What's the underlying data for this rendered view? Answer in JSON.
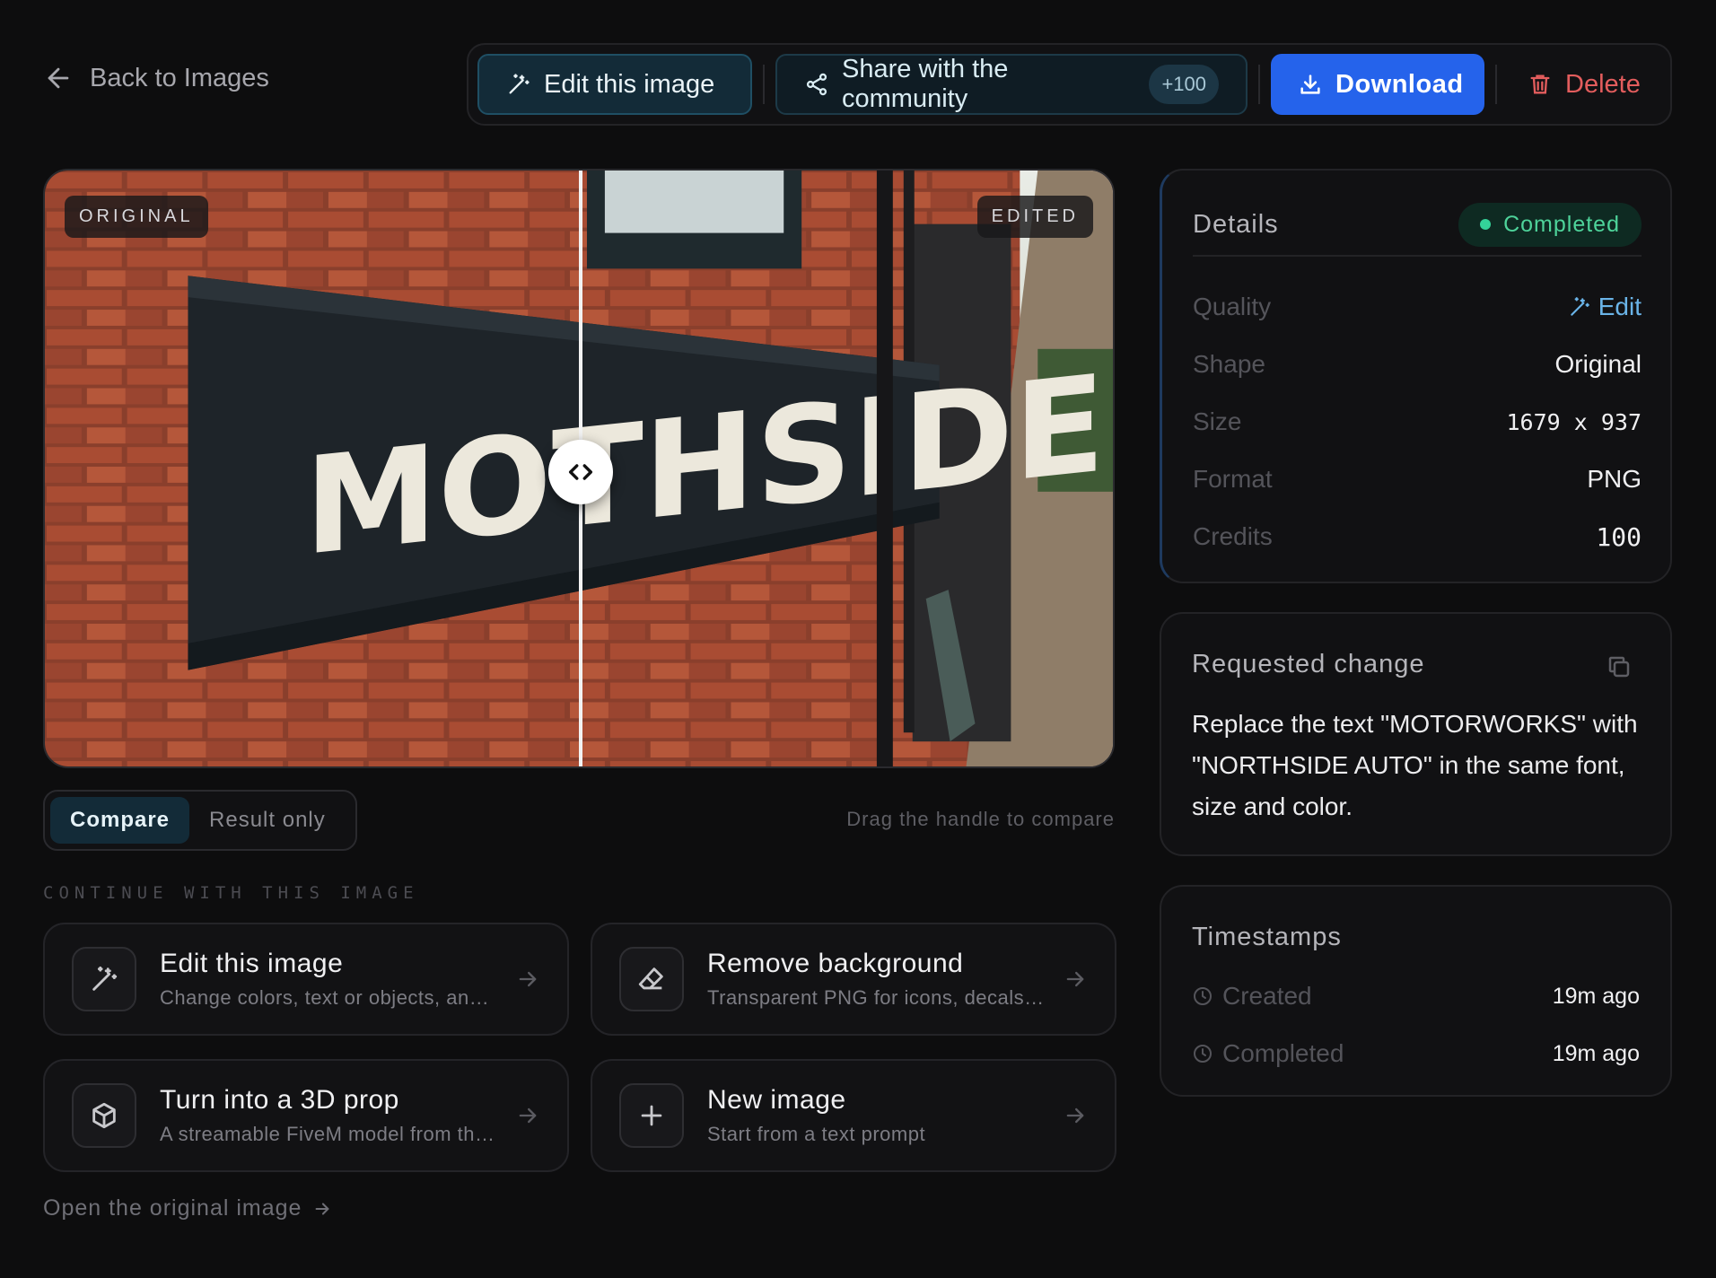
{
  "nav": {
    "back_label": "Back to Images"
  },
  "toolbar": {
    "edit_label": "Edit this image",
    "share_label": "Share with the community",
    "share_badge": "+100",
    "download_label": "Download",
    "delete_label": "Delete"
  },
  "compare": {
    "original_label": "ORIGINAL",
    "edited_label": "EDITED",
    "sign_text": "MOTHSIDE AUTO",
    "modes": [
      "Compare",
      "Result only"
    ],
    "active_mode": "Compare",
    "hint": "Drag the handle to compare"
  },
  "continue": {
    "section_label": "CONTINUE WITH THIS IMAGE",
    "cards": [
      {
        "title": "Edit this image",
        "subtitle": "Change colors, text or objects, and more",
        "icon": "magic-wand-icon"
      },
      {
        "title": "Remove background",
        "subtitle": "Transparent PNG for icons, decals and more",
        "icon": "eraser-icon"
      },
      {
        "title": "Turn into a 3D prop",
        "subtitle": "A streamable FiveM model from this image",
        "icon": "cube-icon"
      },
      {
        "title": "New image",
        "subtitle": "Start from a text prompt",
        "icon": "plus-icon"
      }
    ],
    "open_original": "Open the original image"
  },
  "details": {
    "title": "Details",
    "status": "Completed",
    "rows": [
      {
        "label": "Quality",
        "value": "Edit"
      },
      {
        "label": "Shape",
        "value": "Original"
      },
      {
        "label": "Size",
        "value": "1679 x 937"
      },
      {
        "label": "Format",
        "value": "PNG"
      },
      {
        "label": "Credits",
        "value": "100"
      }
    ]
  },
  "request": {
    "title": "Requested change",
    "text": "Replace the text \"MOTORWORKS\" with \"NORTHSIDE AUTO\" in the same font, size and color."
  },
  "timestamps": {
    "title": "Timestamps",
    "rows": [
      {
        "label": "Created",
        "value": "19m ago"
      },
      {
        "label": "Completed",
        "value": "19m ago"
      }
    ]
  },
  "colors": {
    "accent": "#2563eb",
    "danger": "#e35d5d",
    "success": "#34d399",
    "teal": "#132b38"
  }
}
